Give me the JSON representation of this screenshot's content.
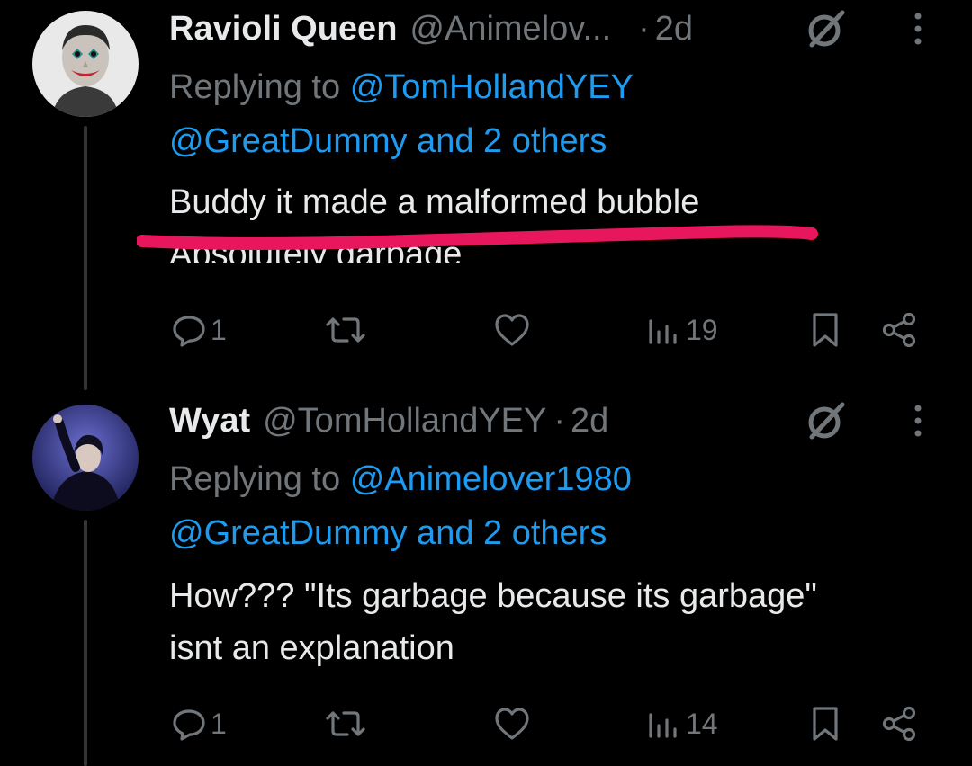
{
  "tweets": [
    {
      "display_name": "Ravioli Queen",
      "handle": "@Animelov...",
      "separator": "·",
      "time": "2d",
      "replying_prefix": "Replying to",
      "replying_to": "@TomHollandYEY",
      "replying_others": "@GreatDummy and 2 others",
      "body_lines": [
        "Buddy it made a malformed bubble",
        "Absolutely garbage"
      ],
      "replies": "1",
      "views": "19"
    },
    {
      "display_name": "Wyat",
      "handle": "@TomHollandYEY",
      "separator": "·",
      "time": "2d",
      "replying_prefix": "Replying to",
      "replying_to": "@Animelover1980",
      "replying_others": "@GreatDummy and 2 others",
      "body_lines": [
        "How??? \"Its garbage because its garbage\"",
        "isnt an explanation"
      ],
      "replies": "1",
      "views": "14"
    }
  ],
  "colors": {
    "background": "#000000",
    "text": "#e7e9ea",
    "muted": "#71767b",
    "link": "#1d9bf0",
    "annotation": "#e8175d"
  },
  "icons": [
    "grok-icon",
    "more-icon",
    "reply-icon",
    "retweet-icon",
    "like-icon",
    "views-icon",
    "bookmark-icon",
    "share-icon"
  ]
}
